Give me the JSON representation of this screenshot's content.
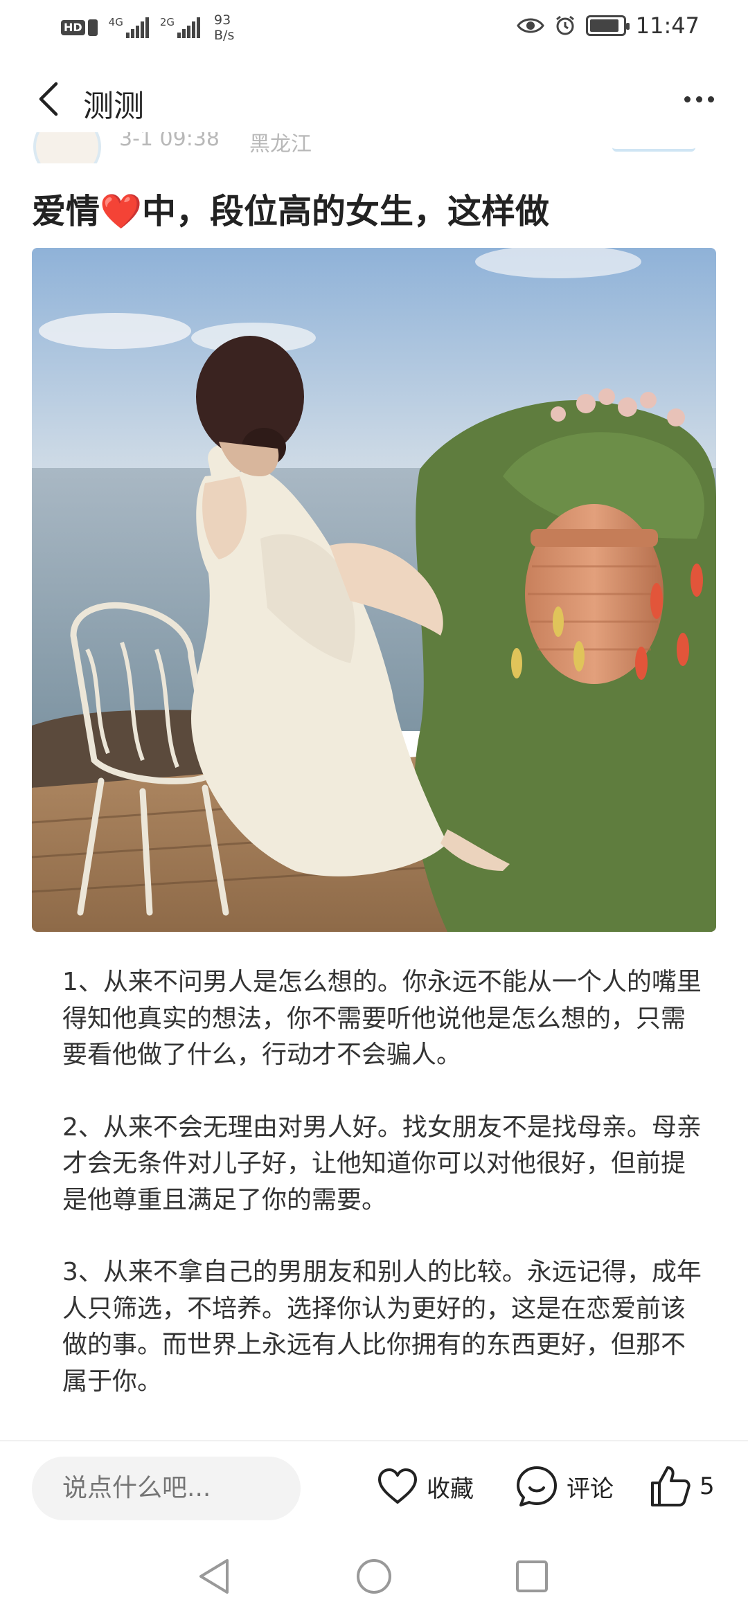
{
  "status_bar": {
    "signal1_label": "4G",
    "signal2_label": "2G",
    "net_speed_value": "93",
    "net_speed_unit": "B/s",
    "time": "11:47",
    "battery_level": 0.9
  },
  "header": {
    "title": "测测"
  },
  "meta": {
    "time": "3-1 09:38",
    "location": "黑龙江"
  },
  "post": {
    "title_before": "爱情",
    "title_emoji": "❤️",
    "title_after": "中，段位高的女生，这样做",
    "paragraphs": [
      "1、从来不问男人是怎么想的。你永远不能从一个人的嘴里得知他真实的想法，你不需要听他说他是怎么想的，只需要看他做了什么，行动才不会骗人。",
      "2、从来不会无理由对男人好。找女朋友不是找母亲。母亲才会无条件对儿子好，让他知道你可以对他很好，但前提是他尊重且满足了你的需要。",
      "3、从来不拿自己的男朋友和别人的比较。永远记得，成年人只筛选，不培养。选择你认为更好的，这是在恋爱前该做的事。而世界上永远有人比你拥有的东西更好，但那不属于你。"
    ]
  },
  "actions": {
    "comment_placeholder": "说点什么吧...",
    "favorite_label": "收藏",
    "comment_label": "评论",
    "like_count": "5"
  },
  "colors": {
    "accent_heart": "#e02626",
    "text_primary": "#222222",
    "text_muted": "#b8b8b8"
  }
}
